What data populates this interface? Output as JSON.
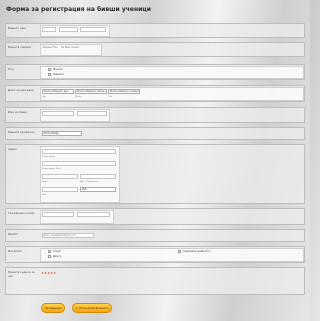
{
  "form_title": "Форма за регистрация на бивши ученици",
  "fields": {
    "name": {
      "label": "Вашето име",
      "subs": [
        "",
        "",
        "",
        ""
      ]
    },
    "photo": {
      "label": "Вашата снимка",
      "button": "Browse Files",
      "status": "No files chosen"
    },
    "gender": {
      "label": "Пол",
      "options": [
        "Мъжки",
        "Женски"
      ]
    },
    "birthdate": {
      "label": "Дата на раждане",
      "selects": [
        "Моля изберете ден",
        "Моля изберете месец",
        "Моля изберете година"
      ],
      "subs": [
        "Ден",
        "Месец",
        "Год"
      ]
    },
    "father_name": {
      "label": "Име на баща",
      "subs": [
        "",
        ""
      ]
    },
    "class": {
      "label": "Вашата професия",
      "select": "Моля Избер"
    },
    "address": {
      "label": "Адрес",
      "subs": [
        "Улица адрес",
        "Улица адрес Ред 2",
        "Град",
        "Щат / Провинция",
        "Код",
        ""
      ],
      "country_select": "Изб."
    },
    "phone": {
      "label": "Телефонен номер",
      "subs": [
        "",
        ""
      ]
    },
    "email": {
      "label": "Имейл",
      "value": "напр. email@example.com"
    },
    "interests": {
      "label": "Интереси",
      "options": [
        "Спорт",
        "Други",
        "Социални дейности"
      ]
    },
    "rating": {
      "label": "Вашата оценка за нас",
      "stars": "★★★★★"
    }
  },
  "buttons": {
    "submit": "Изпращане",
    "print": "Отпечатай формата"
  },
  "colors": {
    "accent": "#f4a712",
    "star": "#d94b1a"
  }
}
